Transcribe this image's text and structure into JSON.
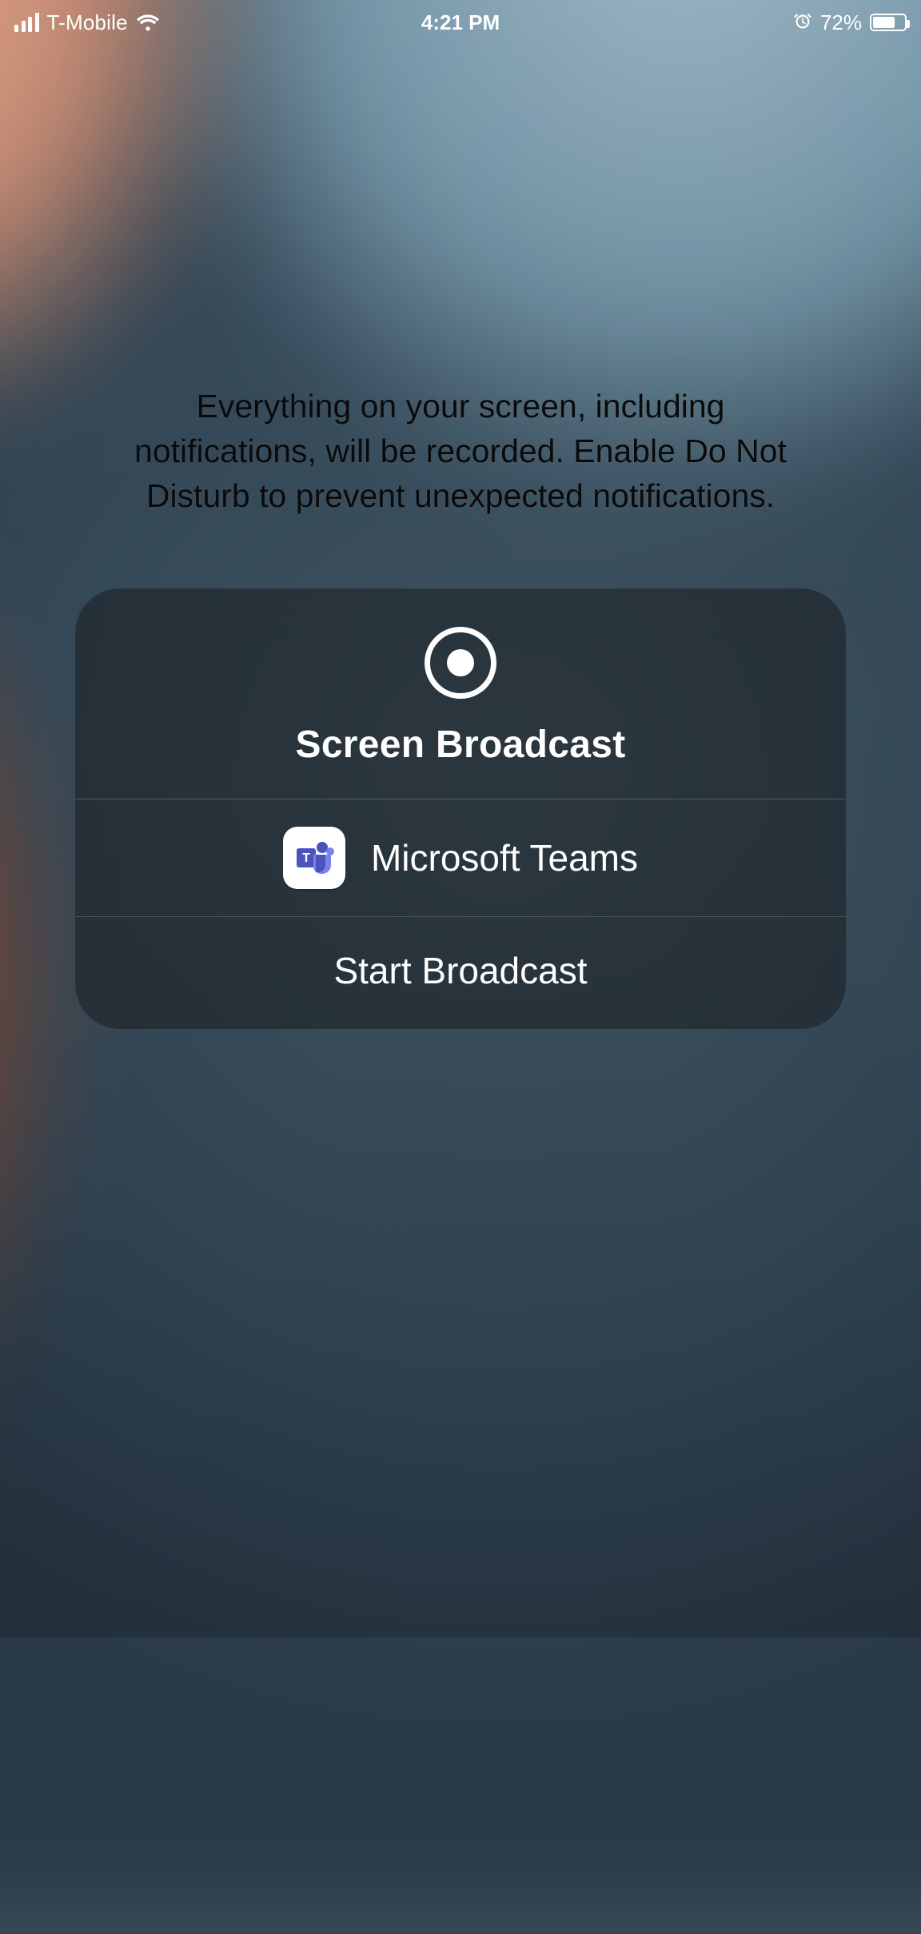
{
  "status_bar": {
    "carrier": "T-Mobile",
    "time": "4:21 PM",
    "battery_percent_text": "72%",
    "battery_fill_percent": 72,
    "alarm_set": true
  },
  "instruction_text": "Everything on your screen, including notifications, will be recorded. Enable Do Not Disturb to prevent unexpected notifications.",
  "broadcast_sheet": {
    "title": "Screen Broadcast",
    "app": {
      "name": "Microsoft Teams",
      "icon": "teams-icon"
    },
    "start_label": "Start Broadcast"
  }
}
